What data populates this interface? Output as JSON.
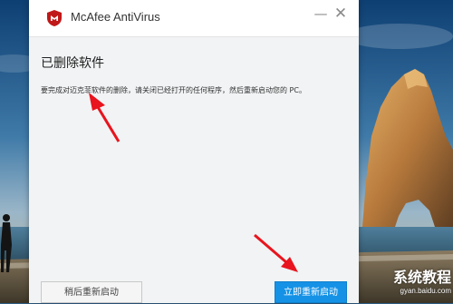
{
  "window": {
    "app_title": "McAfee AntiVirus",
    "brand_color": "#c01818"
  },
  "dialog": {
    "heading": "已删除软件",
    "message": "要完成对迈克菲软件的删除，请关闭已经打开的任何程序，然后重新启动您的 PC。",
    "restart_later_label": "稍后重新启动",
    "restart_now_label": "立即重新启动",
    "primary_color": "#1592e6"
  },
  "watermark": {
    "main": "系统教程",
    "sub": "gyan.baidu.com"
  }
}
